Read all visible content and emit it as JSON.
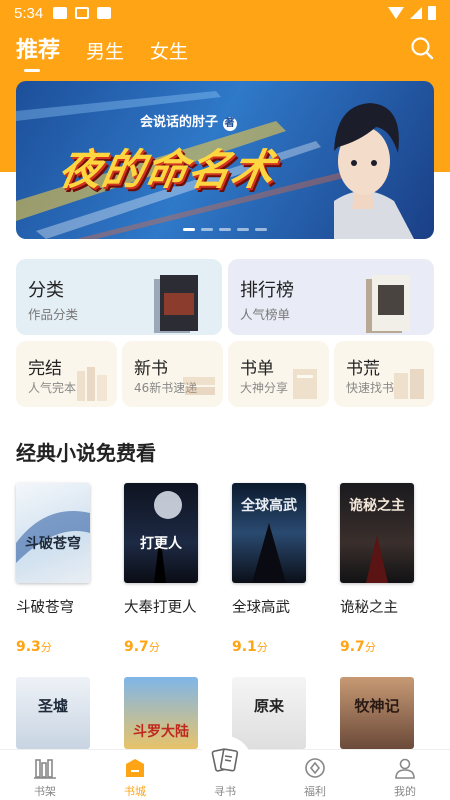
{
  "status_bar": {
    "time": "5:34"
  },
  "tabs": [
    {
      "label": "推荐",
      "active": true
    },
    {
      "label": "男生",
      "active": false
    },
    {
      "label": "女生",
      "active": false
    }
  ],
  "banner": {
    "author": "会说话的肘子",
    "author_badge": "著",
    "title": "夜的命名术",
    "slide_count": 5,
    "active_slide": 1
  },
  "feature_cards": [
    {
      "title": "分类",
      "subtitle": "作品分类"
    },
    {
      "title": "排行榜",
      "subtitle": "人气榜单"
    }
  ],
  "small_cards": [
    {
      "title": "完结",
      "subtitle": "人气完本"
    },
    {
      "title": "新书",
      "subtitle": "46新书速递"
    },
    {
      "title": "书单",
      "subtitle": "大神分享"
    },
    {
      "title": "书荒",
      "subtitle": "快速找书"
    }
  ],
  "section": {
    "title": "经典小说免费看"
  },
  "books": [
    {
      "name": "斗破苍穹",
      "score": "9.3",
      "unit": "分",
      "cover_text": "斗破苍穹"
    },
    {
      "name": "大奉打更人",
      "score": "9.7",
      "unit": "分",
      "cover_text": "打更人"
    },
    {
      "name": "全球高武",
      "score": "9.1",
      "unit": "分",
      "cover_text": "全球高武"
    },
    {
      "name": "诡秘之主",
      "score": "9.7",
      "unit": "分",
      "cover_text": "诡秘之主"
    }
  ],
  "books_row2": [
    {
      "cover_text": "圣墟"
    },
    {
      "cover_text": "斗罗大陆"
    },
    {
      "cover_text": "原来"
    },
    {
      "cover_text": "牧神记"
    }
  ],
  "bottom_nav": [
    {
      "label": "书架",
      "icon": "bookshelf-icon",
      "active": false
    },
    {
      "label": "书城",
      "icon": "bookstore-icon",
      "active": true
    },
    {
      "label": "寻书",
      "icon": "find-book-icon",
      "active": false
    },
    {
      "label": "福利",
      "icon": "welfare-icon",
      "active": false
    },
    {
      "label": "我的",
      "icon": "profile-icon",
      "active": false
    }
  ],
  "colors": {
    "accent": "#FFA415",
    "feature_card_1": "#E4EEF5",
    "feature_card_2": "#E9ECF6",
    "small_card": "#FBF6EB"
  }
}
